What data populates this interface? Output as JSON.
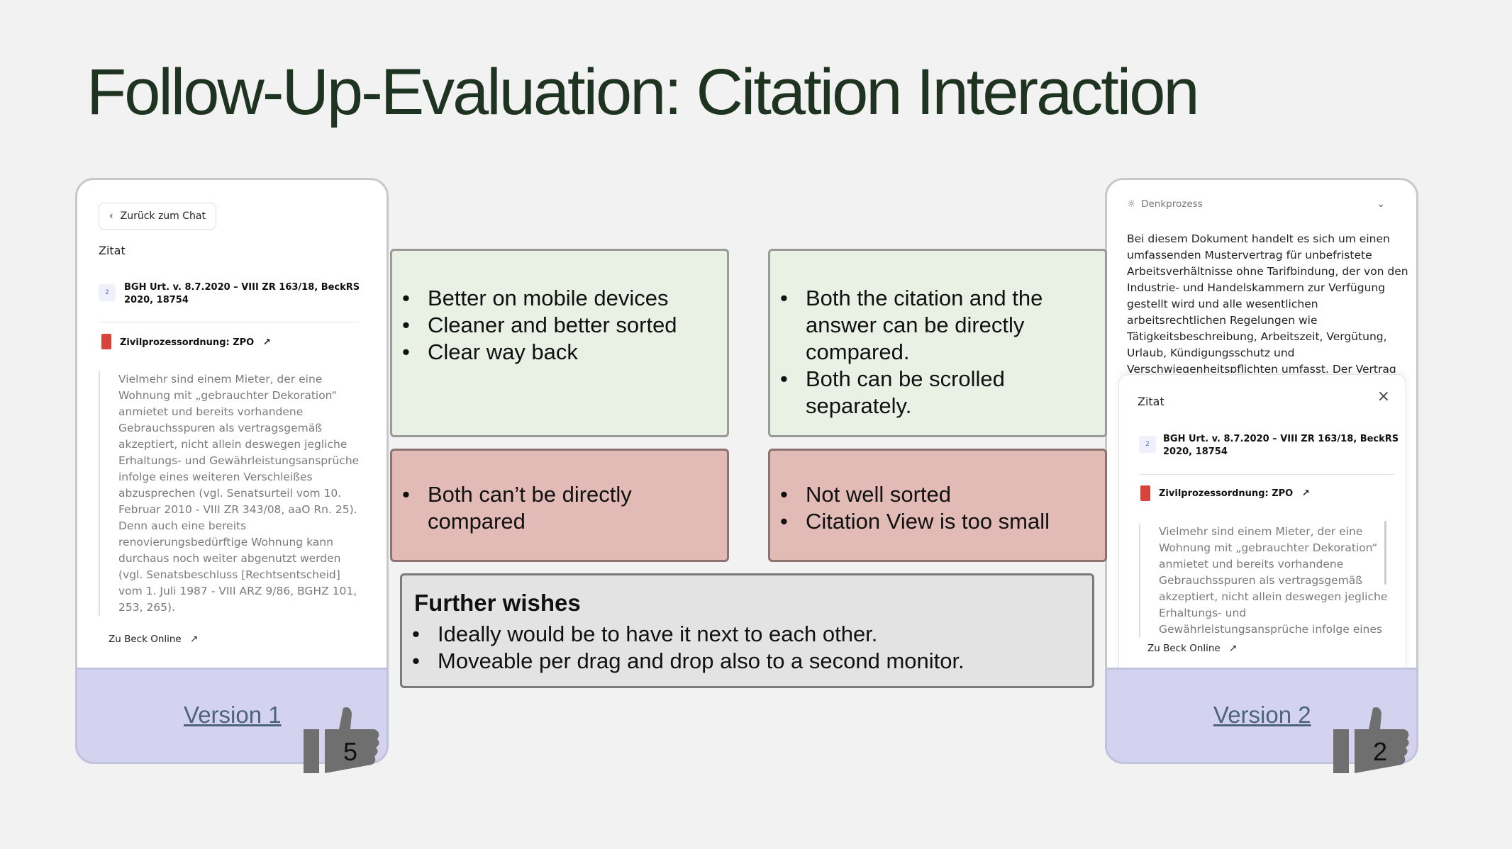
{
  "title": "Follow-Up-Evaluation: Citation Interaction",
  "version1": {
    "back_button": "Zurück zum Chat",
    "zitat_label": "Zitat",
    "source_badge": "2",
    "source_line1": "BGH Urt. v. 8.7.2020 – VIII ZR 163/18, BeckRS",
    "source_line2": "2020, 18754",
    "law_title": "Zivilprozessordnung: ZPO",
    "quote": "Vielmehr sind einem Mieter, der eine Wohnung mit „gebrauchter Dekoration“ anmietet und bereits vorhandene Gebrauchsspuren als vertragsgemäß akzeptiert, nicht allein deswegen jegliche Erhaltungs- und Gewährleistungsansprüche infolge eines weiteren Verschleißes abzusprechen (vgl. Senatsurteil vom 10. Februar 2010 - VIII ZR 343/08, aaO Rn. 25). Denn auch eine bereits renovierungsbedürftige Wohnung kann durchaus noch weiter abgenutzt werden (vgl. Senatsbeschluss [Rechtsentscheid] vom 1. Juli 1987 - VIII ARZ 9/86, BGHZ 101, 253, 265).",
    "beck_link": "Zu Beck Online",
    "version_label": "Version 1",
    "rating": "5"
  },
  "version2": {
    "denk_label": "Denkprozess",
    "denk_text": "Bei diesem Dokument handelt es sich um einen umfassenden Mustervertrag für unbefristete Arbeitsverhältnisse ohne Tarifbindung, der von den Industrie- und Handelskammern zur Verfügung gestellt wird und alle wesentlichen arbeitsrechtlichen Regelungen wie Tätigkeitsbeschreibung, Arbeitszeit, Vergütung, Urlaub, Kündigungsschutz und Verschwiegenheitspflichten umfasst. Der Vertrag",
    "zitat_label": "Zitat",
    "source_badge": "2",
    "source_line1": "BGH Urt. v. 8.7.2020 – VIII ZR 163/18, BeckRS",
    "source_line2": "2020, 18754",
    "law_title": "Zivilprozessordnung: ZPO",
    "quote": "Vielmehr sind einem Mieter, der eine Wohnung mit „gebrauchter Dekoration“ anmietet und bereits vorhandene Gebrauchsspuren als vertragsgemäß akzeptiert, nicht allein deswegen jegliche Erhaltungs- und Gewährleistungsansprüche infolge eines",
    "beck_link": "Zu Beck Online",
    "version_label": "Version 2",
    "rating": "2"
  },
  "pros_v1": [
    "Better on mobile devices",
    "Cleaner and better sorted",
    "Clear way back"
  ],
  "pros_v2": [
    "Both the citation and the answer can be directly compared.",
    "Both can be scrolled separately."
  ],
  "cons_v1": [
    "Both can’t be directly compared"
  ],
  "cons_v2": [
    "Not well sorted",
    "Citation View is too small"
  ],
  "wishes": {
    "title": "Further wishes",
    "items": [
      "Ideally would be to have it next to each other.",
      "Moveable per drag and drop also to a second monitor."
    ]
  }
}
